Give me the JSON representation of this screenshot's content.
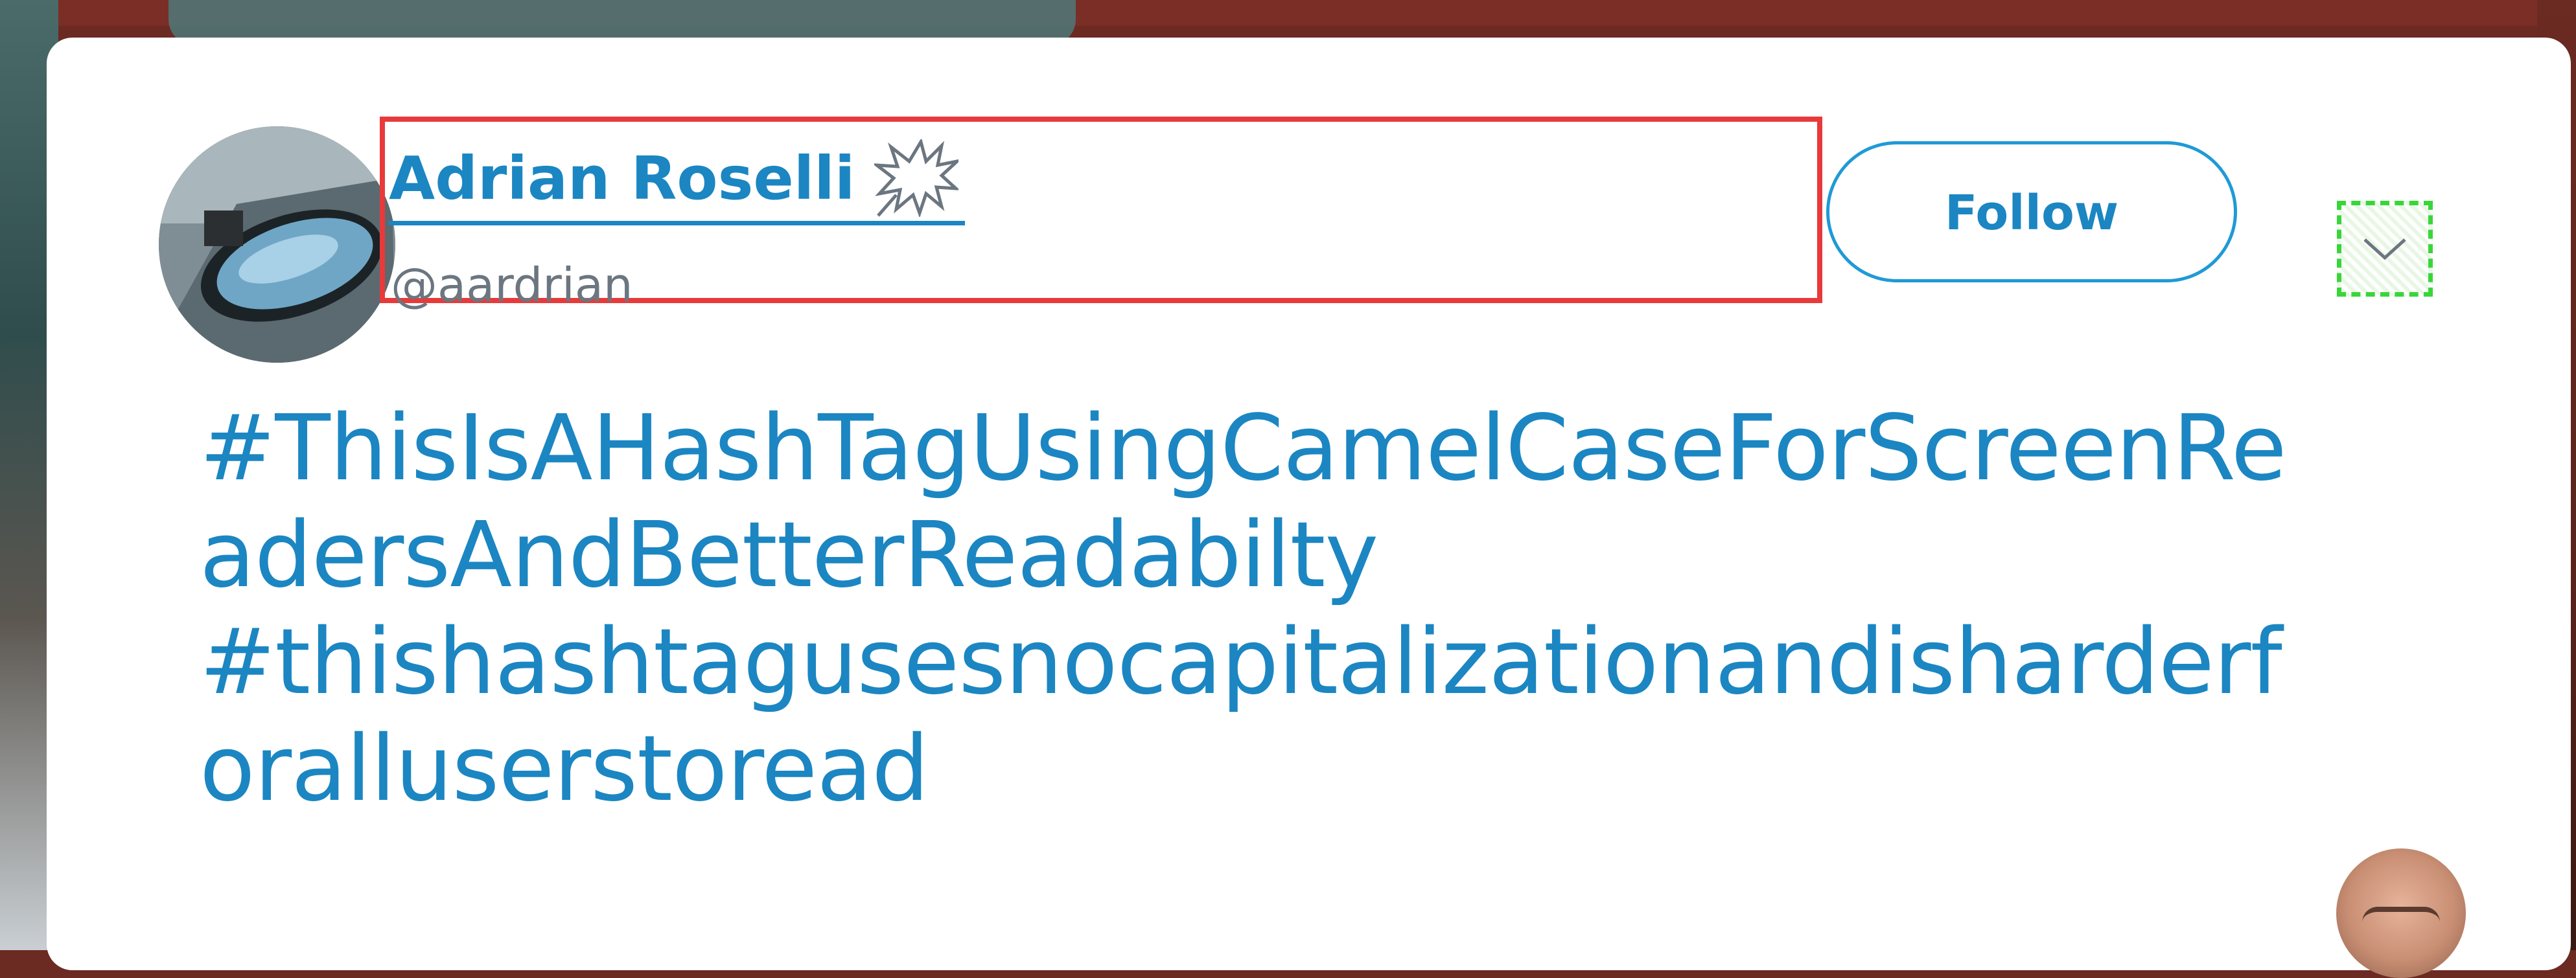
{
  "tweet": {
    "author_name": "Adrian Roselli",
    "author_handle": "@aardrian",
    "author_badge_icon": "speech-burst-icon",
    "follow_label": "Follow",
    "menu_icon": "chevron-down-icon",
    "text_lines": [
      "#ThisIsAHashTagUsingCamelCaseForScreenRe",
      "adersAndBetterReadabilty",
      "#thishashtagusesnocapitalizationandisharderf",
      "oralluserstoread"
    ]
  },
  "colors": {
    "link_blue": "#1b86c2",
    "follow_border": "#1f9ad6",
    "highlight_red": "#e83a3a",
    "highlight_green": "#39d63a"
  }
}
